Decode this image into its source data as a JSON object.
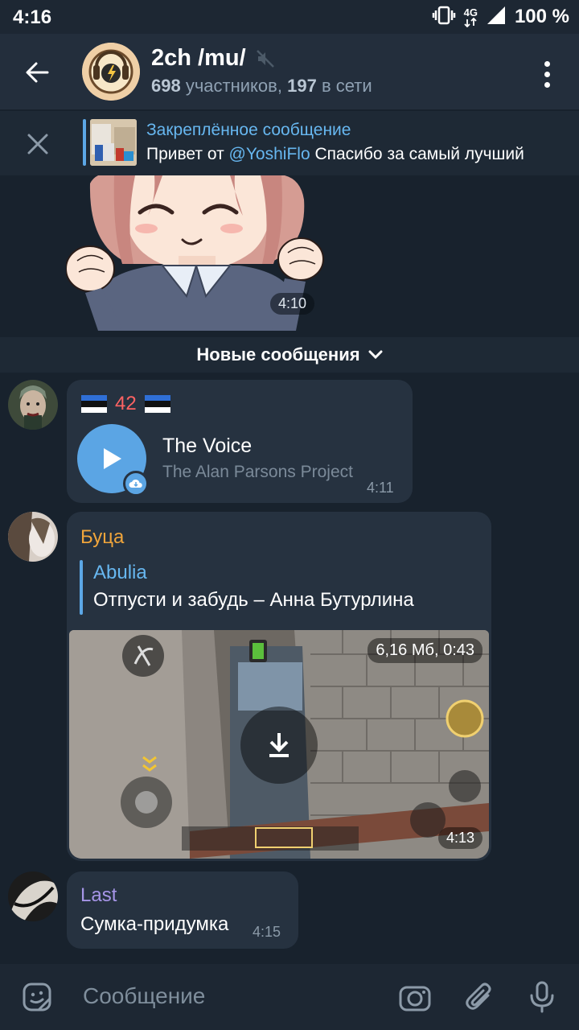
{
  "status_bar": {
    "time": "4:16",
    "network": "4G",
    "battery": "100 %"
  },
  "header": {
    "title": "2ch /mu/",
    "members_count": "698",
    "members_label": "участников,",
    "online_count": "197",
    "online_label": "в сети",
    "icons": [
      "back-arrow-icon",
      "muted-icon",
      "more-vert-icon"
    ]
  },
  "pinned": {
    "title": "Закреплённое сообщение",
    "text_before": "Привет от ",
    "mention": "@YoshiFlo",
    "text_after": "  Спасибо за  самый лучший"
  },
  "sticker": {
    "time": "4:10"
  },
  "new_messages": {
    "label": "Новые сообщения"
  },
  "messages": [
    {
      "type": "audio",
      "caption_number": "42",
      "caption_emoji": "estonian-flag",
      "title": "The Voice",
      "artist": "The Alan Parsons Project",
      "time": "4:11"
    },
    {
      "type": "video",
      "sender": "Буца",
      "sender_color": "#f0a53b",
      "reply_name": "Abulia",
      "reply_text": "Отпусти и забудь – Анна Бутурлина",
      "video_info": "6,16 Мб, 0:43",
      "time": "4:13"
    },
    {
      "type": "text",
      "sender": "Last",
      "sender_color": "#a695e7",
      "text": "Сумка-придумка",
      "time": "4:15"
    }
  ],
  "input": {
    "placeholder": "Сообщение"
  },
  "colors": {
    "accent": "#5ba5e4",
    "bubble": "#263240",
    "background": "#18222d"
  }
}
